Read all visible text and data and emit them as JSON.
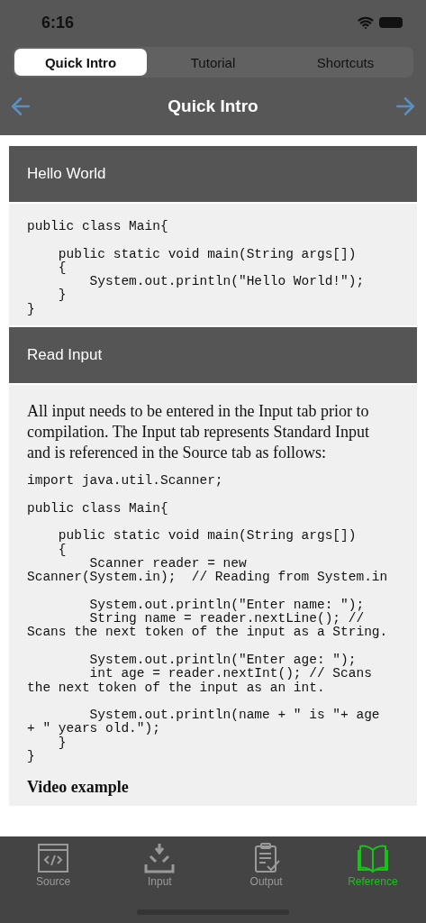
{
  "status_bar": {
    "time": "6:16"
  },
  "segments": [
    {
      "label": "Quick Intro",
      "selected": true
    },
    {
      "label": "Tutorial",
      "selected": false
    },
    {
      "label": "Shortcuts",
      "selected": false
    }
  ],
  "nav": {
    "title": "Quick Intro"
  },
  "sections": [
    {
      "title": "Hello World",
      "code": "public class Main{\n\n    public static void main(String args[])\n    {\n        System.out.println(\"Hello World!\");\n    }\n}"
    },
    {
      "title": "Read Input",
      "paragraph": "All input needs to be entered in the Input tab prior to compilation. The Input tab represents Standard Input and is referenced in the Source tab as follows:",
      "code": "import java.util.Scanner;\n\npublic class Main{\n\n    public static void main(String args[])\n    {\n        Scanner reader = new\nScanner(System.in);  // Reading from System.in\n\n        System.out.println(\"Enter name: \");\n        String name = reader.nextLine(); //\nScans the next token of the input as a String.\n\n        System.out.println(\"Enter age: \");\n        int age = reader.nextInt(); // Scans\nthe next token of the input as an int.\n\n        System.out.println(name + \" is \"+ age\n+ \" years old.\");\n    }\n}",
      "subheading": "Video example"
    }
  ],
  "tab_bar": [
    {
      "label": "Source",
      "kind": "source",
      "selected": false
    },
    {
      "label": "Input",
      "kind": "input",
      "selected": false
    },
    {
      "label": "Output",
      "kind": "output",
      "selected": false
    },
    {
      "label": "Reference",
      "kind": "reference",
      "selected": true
    }
  ]
}
